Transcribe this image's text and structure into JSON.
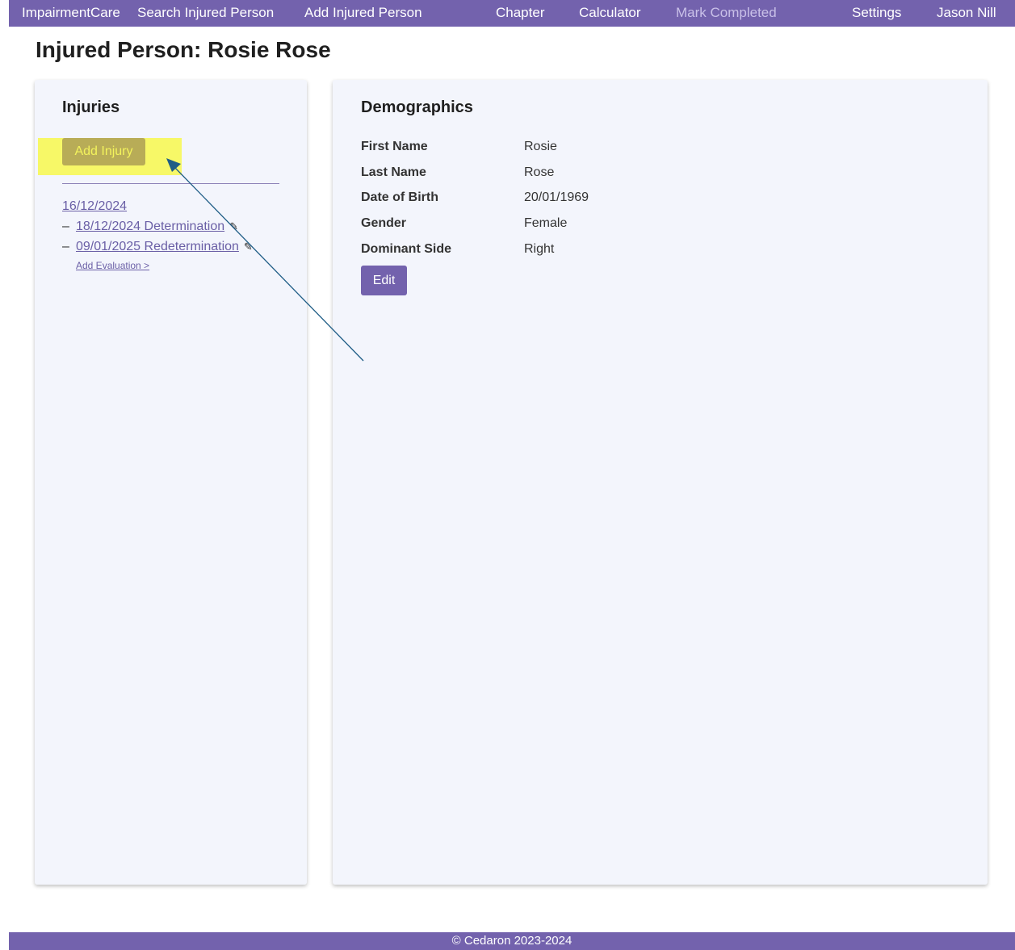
{
  "nav": {
    "brand": "ImpairmentCare",
    "search_injured_person": "Search Injured Person",
    "add_injured_person": "Add Injured Person",
    "chapter": "Chapter",
    "calculator": "Calculator",
    "mark_completed": "Mark Completed",
    "settings": "Settings",
    "user": "Jason Nill"
  },
  "page": {
    "title": "Injured Person: Rosie Rose"
  },
  "injuries": {
    "heading": "Injuries",
    "add_injury_label": "Add Injury",
    "injury_date": "16/12/2024",
    "evaluations": [
      {
        "dash": "–",
        "label": "18/12/2024 Determination",
        "icon": "pencil-icon"
      },
      {
        "dash": "–",
        "label": "09/01/2025 Redetermination",
        "icon": "pencil-icon"
      }
    ],
    "add_evaluation_label": "Add Evaluation >"
  },
  "demographics": {
    "heading": "Demographics",
    "rows": [
      {
        "label": "First Name",
        "value": "Rosie"
      },
      {
        "label": "Last Name",
        "value": "Rose"
      },
      {
        "label": "Date of Birth",
        "value": "20/01/1969"
      },
      {
        "label": "Gender",
        "value": "Female"
      },
      {
        "label": "Dominant Side",
        "value": "Right"
      }
    ],
    "edit_label": "Edit"
  },
  "footer": {
    "text": "© Cedaron 2023-2024"
  },
  "colors": {
    "brand": "#7362ad",
    "highlight": "#f7f75a",
    "card_bg": "#f3f5fc",
    "arrow": "#1f5d86"
  }
}
